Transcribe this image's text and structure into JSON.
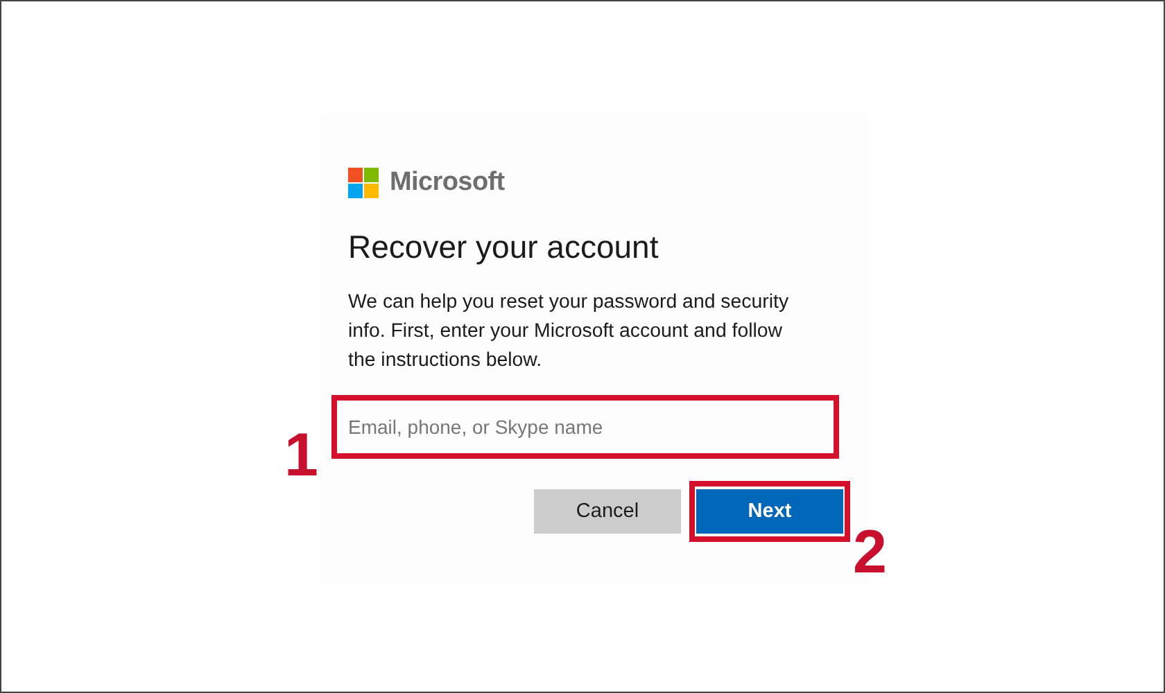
{
  "logo": {
    "text": "Microsoft"
  },
  "title": "Recover your account",
  "description": "We can help you reset your password and security info. First, enter your Microsoft account and follow the instructions below.",
  "email_field": {
    "placeholder": "Email, phone, or Skype name"
  },
  "buttons": [
    {
      "label": "Cancel",
      "kind": "secondary"
    },
    {
      "label": "Next",
      "kind": "primary"
    }
  ],
  "annotations": [
    {
      "label": "1"
    },
    {
      "label": "2"
    }
  ]
}
